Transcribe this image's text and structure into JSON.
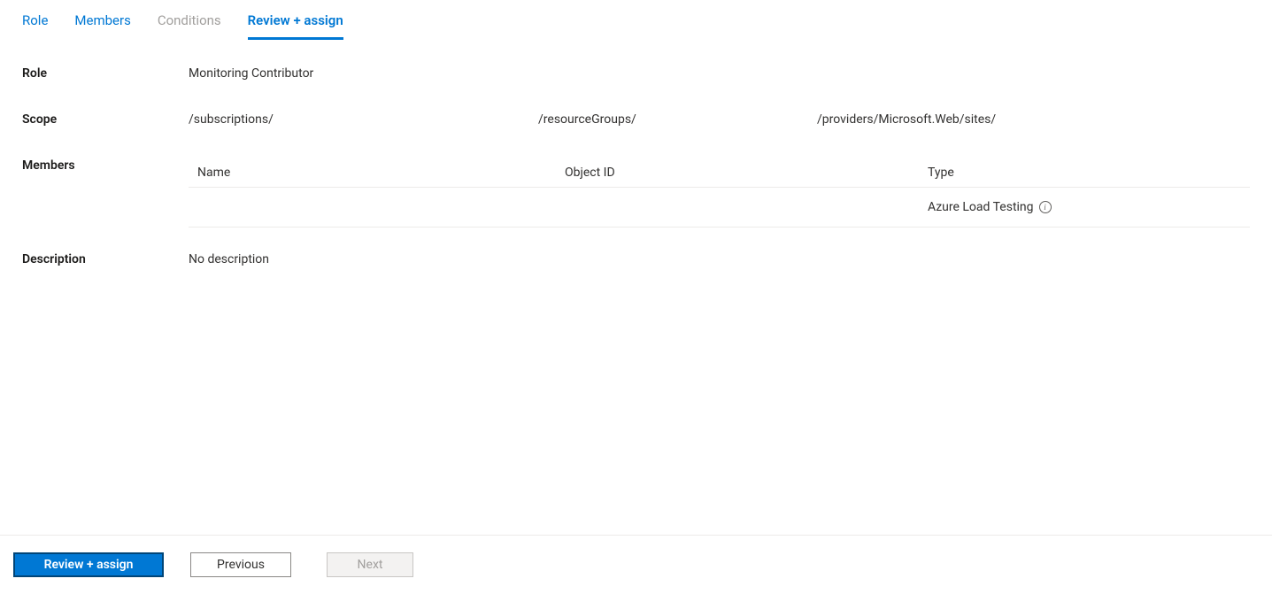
{
  "tabs": {
    "role": "Role",
    "members": "Members",
    "conditions": "Conditions",
    "review": "Review + assign"
  },
  "fields": {
    "role_label": "Role",
    "role_value": "Monitoring Contributor",
    "scope_label": "Scope",
    "scope_parts": {
      "subscriptions": "/subscriptions/",
      "resourceGroups": "/resourceGroups/",
      "providers": "/providers/Microsoft.Web/sites/"
    },
    "members_label": "Members",
    "description_label": "Description",
    "description_value": "No description"
  },
  "members_table": {
    "headers": {
      "name": "Name",
      "object_id": "Object ID",
      "type": "Type"
    },
    "rows": [
      {
        "name": "",
        "object_id": "",
        "type": "Azure Load Testing"
      }
    ]
  },
  "footer": {
    "review_assign": "Review + assign",
    "previous": "Previous",
    "next": "Next"
  },
  "icons": {
    "info": "i"
  }
}
